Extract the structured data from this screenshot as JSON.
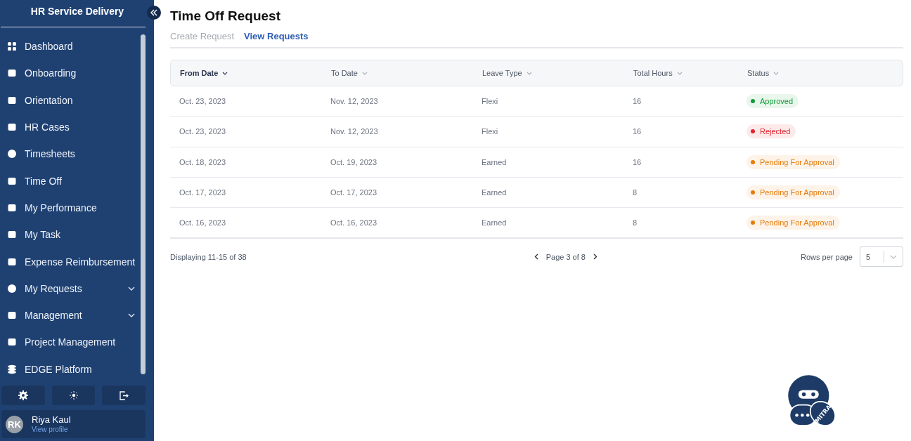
{
  "sidebar": {
    "title": "HR Service Delivery",
    "items": [
      {
        "label": "Dashboard",
        "expandable": false
      },
      {
        "label": "Onboarding",
        "expandable": false
      },
      {
        "label": "Orientation",
        "expandable": false
      },
      {
        "label": "HR Cases",
        "expandable": false
      },
      {
        "label": "Timesheets",
        "expandable": false
      },
      {
        "label": "Time Off",
        "expandable": false
      },
      {
        "label": "My Performance",
        "expandable": false
      },
      {
        "label": "My Task",
        "expandable": false
      },
      {
        "label": "Expense Reimbursement",
        "expandable": false
      },
      {
        "label": "My Requests",
        "expandable": true
      },
      {
        "label": "Management",
        "expandable": true
      },
      {
        "label": "Project Management",
        "expandable": false
      },
      {
        "label": "EDGE Platform",
        "expandable": false
      }
    ],
    "user": {
      "initials": "RK",
      "name": "Riya Kaul",
      "link": "View profile"
    }
  },
  "page": {
    "title": "Time Off Request",
    "tabs": [
      {
        "label": "Create Request",
        "selected": false
      },
      {
        "label": "View Requests",
        "selected": true
      }
    ]
  },
  "table": {
    "columns": [
      {
        "label": "From Date",
        "sorted": true
      },
      {
        "label": "To Date",
        "sorted": false
      },
      {
        "label": "Leave Type",
        "sorted": false
      },
      {
        "label": "Total Hours",
        "sorted": false
      },
      {
        "label": "Status",
        "sorted": false
      }
    ],
    "rows": [
      {
        "from": "Oct. 23, 2023",
        "to": "Nov. 12, 2023",
        "type": "Flexi",
        "hours": "16",
        "status": "Approved",
        "color": "#139b3a"
      },
      {
        "from": "Oct. 23, 2023",
        "to": "Nov. 12, 2023",
        "type": "Flexi",
        "hours": "16",
        "status": "Rejected",
        "color": "#e0242f"
      },
      {
        "from": "Oct. 18, 2023",
        "to": "Oct. 19, 2023",
        "type": "Earned",
        "hours": "16",
        "status": "Pending For Approval",
        "color": "#e57c0b"
      },
      {
        "from": "Oct. 17, 2023",
        "to": "Oct. 17, 2023",
        "type": "Earned",
        "hours": "8",
        "status": "Pending For Approval",
        "color": "#e57c0b"
      },
      {
        "from": "Oct. 16, 2023",
        "to": "Oct. 16, 2023",
        "type": "Earned",
        "hours": "8",
        "status": "Pending For Approval",
        "color": "#e57c0b"
      }
    ]
  },
  "pagination": {
    "summary": "Displaying 11-15 of 38",
    "page": "Page 3 of 8",
    "rows_label": "Rows per page",
    "rows_value": "5"
  },
  "chatbot": {
    "label": "MITRA"
  }
}
